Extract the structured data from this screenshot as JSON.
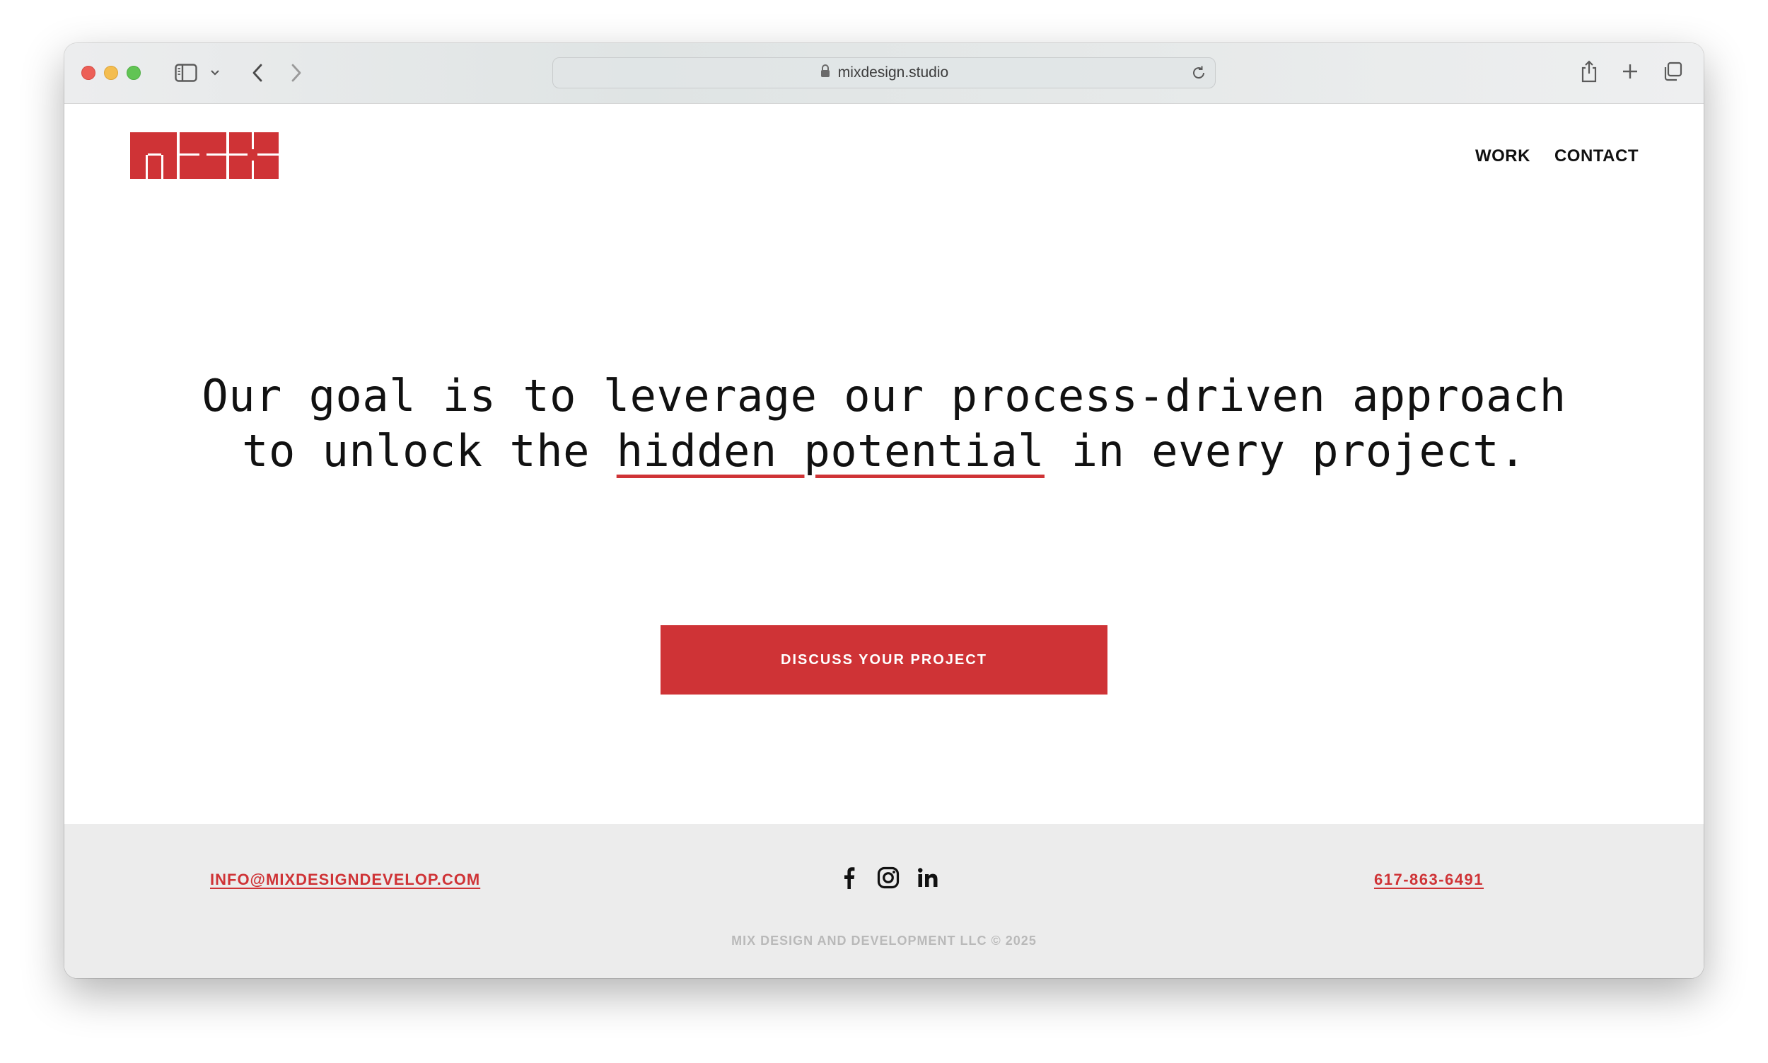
{
  "browser": {
    "url": "mixdesign.studio",
    "colors": {
      "close": "#ec5f57",
      "minimize": "#f4bd4f",
      "maximize": "#61c454"
    },
    "icons": [
      "sidebar-icon",
      "chevron-down-icon",
      "back-icon",
      "forward-icon",
      "lock-icon",
      "reload-icon",
      "share-icon",
      "new-tab-icon",
      "tabs-overview-icon"
    ]
  },
  "site": {
    "brand_color": "#cf3336",
    "logo_icon": "mix-logo-icon",
    "nav": {
      "work": "WORK",
      "contact": "CONTACT"
    },
    "headline": {
      "line1": "Our goal is to leverage our process-driven approach",
      "line2_before": "to unlock the ",
      "line2_highlight": "hidden potential",
      "line2_after": " in every project."
    },
    "cta_label": "DISCUSS YOUR PROJECT",
    "footer": {
      "email": "INFO@MIXDESIGNDEVELOP.COM",
      "phone": "617-863-6491",
      "social_icons": [
        "facebook-icon",
        "instagram-icon",
        "linkedin-icon"
      ],
      "copyright": "MIX DESIGN AND DEVELOPMENT LLC © 2025"
    }
  }
}
